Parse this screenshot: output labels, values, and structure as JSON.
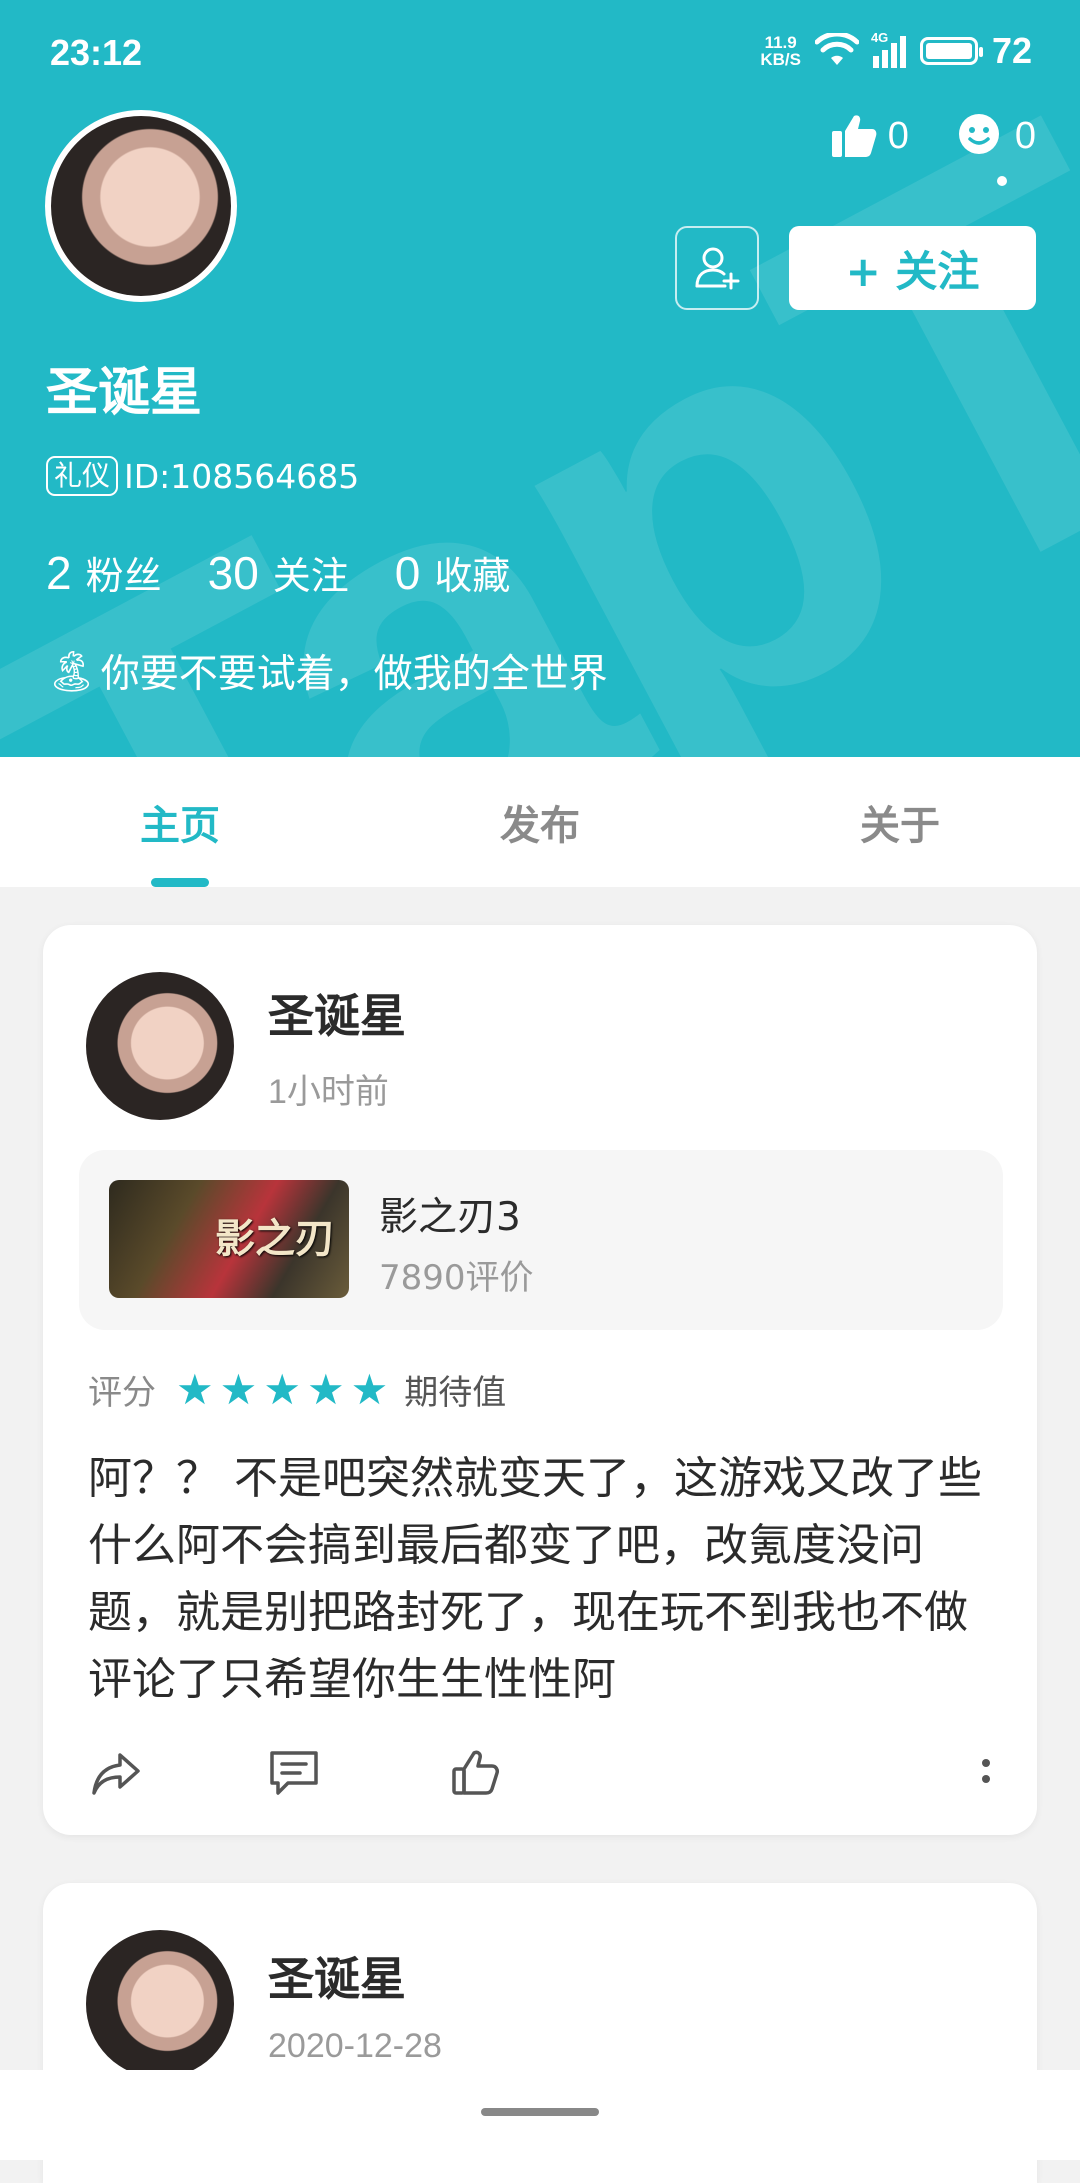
{
  "status_bar": {
    "time": "23:12",
    "net_speed_value": "11.9",
    "net_speed_unit": "KB/S",
    "signal_label": "4G",
    "battery": "72"
  },
  "profile": {
    "username": "圣诞星",
    "badge": "礼仪",
    "id_text": "ID:108564685",
    "likes": "0",
    "messages": "0",
    "follow_label": "+ 关注",
    "stats": [
      {
        "num": "2",
        "label": "粉丝"
      },
      {
        "num": "30",
        "label": "关注"
      },
      {
        "num": "0",
        "label": "收藏"
      }
    ],
    "bio_emoji": "🏝",
    "bio": "你要不要试着，做我的全世界"
  },
  "tabs": [
    {
      "label": "主页",
      "active": true
    },
    {
      "label": "发布",
      "active": false
    },
    {
      "label": "关于",
      "active": false
    }
  ],
  "posts": [
    {
      "author": "圣诞星",
      "time": "1小时前",
      "game": {
        "name": "影之刃3",
        "reviews": "7890评价",
        "cover_text": "影之刃"
      },
      "rating_label": "评分",
      "rating_stars": 5,
      "rating_suffix": "期待值",
      "text": "阿？？ 不是吧突然就变天了，这游戏又改了些什么阿不会搞到最后都变了吧，改氪度没问题，就是别把路封死了，现在玩不到我也不做评论了只希望你生生性性阿"
    },
    {
      "author": "圣诞星",
      "time": "2020-12-28"
    }
  ],
  "colors": {
    "accent": "#22b9c6",
    "background": "#f2f2f2"
  }
}
